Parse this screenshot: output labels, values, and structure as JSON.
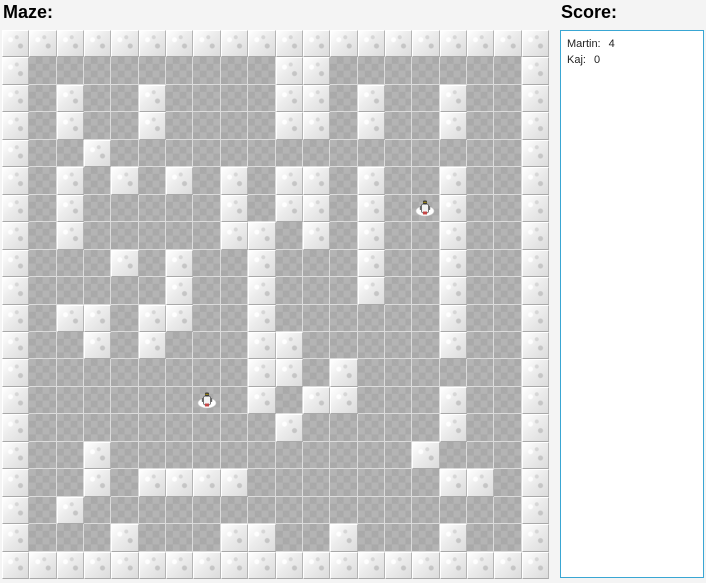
{
  "maze_heading": "Maze:",
  "score_heading": "Score:",
  "scores": [
    {
      "name": "Martin:",
      "value": "4"
    },
    {
      "name": "Kaj:",
      "value": "0"
    }
  ],
  "maze": {
    "rows": [
      "####################",
      "#.........##.......#",
      "#.#..#....##.#..#..#",
      "#.#..#....##.#..#..#",
      "#..#...............#",
      "#.#.#.#.#.##.#..#..#",
      "#.#.....#.##.#.P#..#",
      "#.#.....##.#.#..#..#",
      "#...#.#..#...#..#..#",
      "#.....#..#...#..#..#",
      "#.##.##..#......#..#",
      "#..#.#...##.....#..#",
      "#........##.#......#",
      "#......P.#.##...#..#",
      "#.........#.....#..#",
      "#..#...........#...#",
      "#..#.####.......##.#",
      "#.#................#",
      "#...#...##..#...#..#",
      "####################"
    ],
    "legend": {
      "wall": "#",
      "floor": ".",
      "player": "P"
    },
    "wall_icon": "stone-block",
    "player_icon": "robot-player"
  }
}
